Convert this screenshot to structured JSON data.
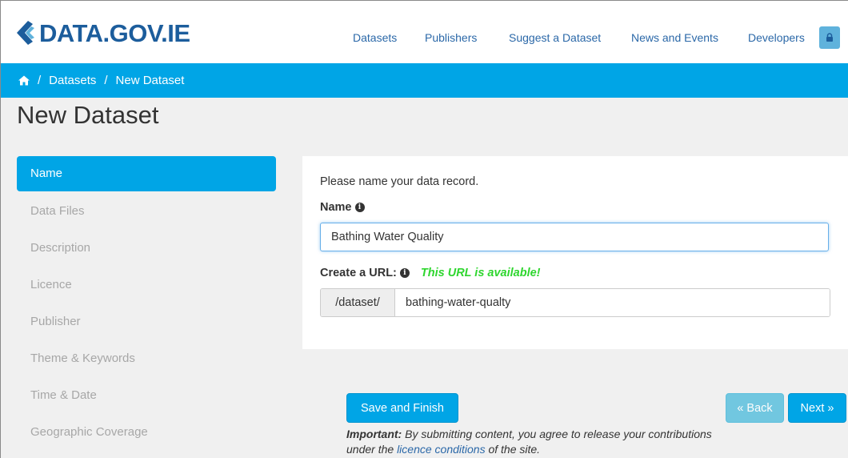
{
  "header": {
    "logo_text": "DATA.GOV.IE",
    "nav": [
      "Datasets",
      "Publishers",
      "Suggest a Dataset",
      "News and Events",
      "Developers"
    ],
    "lock_icon": "lock-icon"
  },
  "breadcrumb": {
    "home_icon": "home-icon",
    "items": [
      "Datasets",
      "New Dataset"
    ],
    "separator": "/"
  },
  "page": {
    "title": "New Dataset"
  },
  "steps": [
    "Name",
    "Data Files",
    "Description",
    "Licence",
    "Publisher",
    "Theme & Keywords",
    "Time & Date",
    "Geographic Coverage"
  ],
  "form": {
    "intro": "Please name your data record.",
    "name_label": "Name",
    "name_value": "Bathing Water Quality",
    "url_label": "Create a URL:",
    "url_status": "This URL is available!",
    "url_prefix": "/dataset/",
    "url_value": "bathing-water-qualty"
  },
  "buttons": {
    "save": "Save and Finish",
    "back": "« Back",
    "next": "Next »"
  },
  "notice": {
    "strong": "Important:",
    "text_before": " By submitting content, you agree to release your contributions under the ",
    "link": "licence conditions",
    "text_after": " of the site."
  },
  "colors": {
    "brand": "#1c5d9c",
    "accent": "#00a5e6",
    "available": "#2fd62f"
  }
}
